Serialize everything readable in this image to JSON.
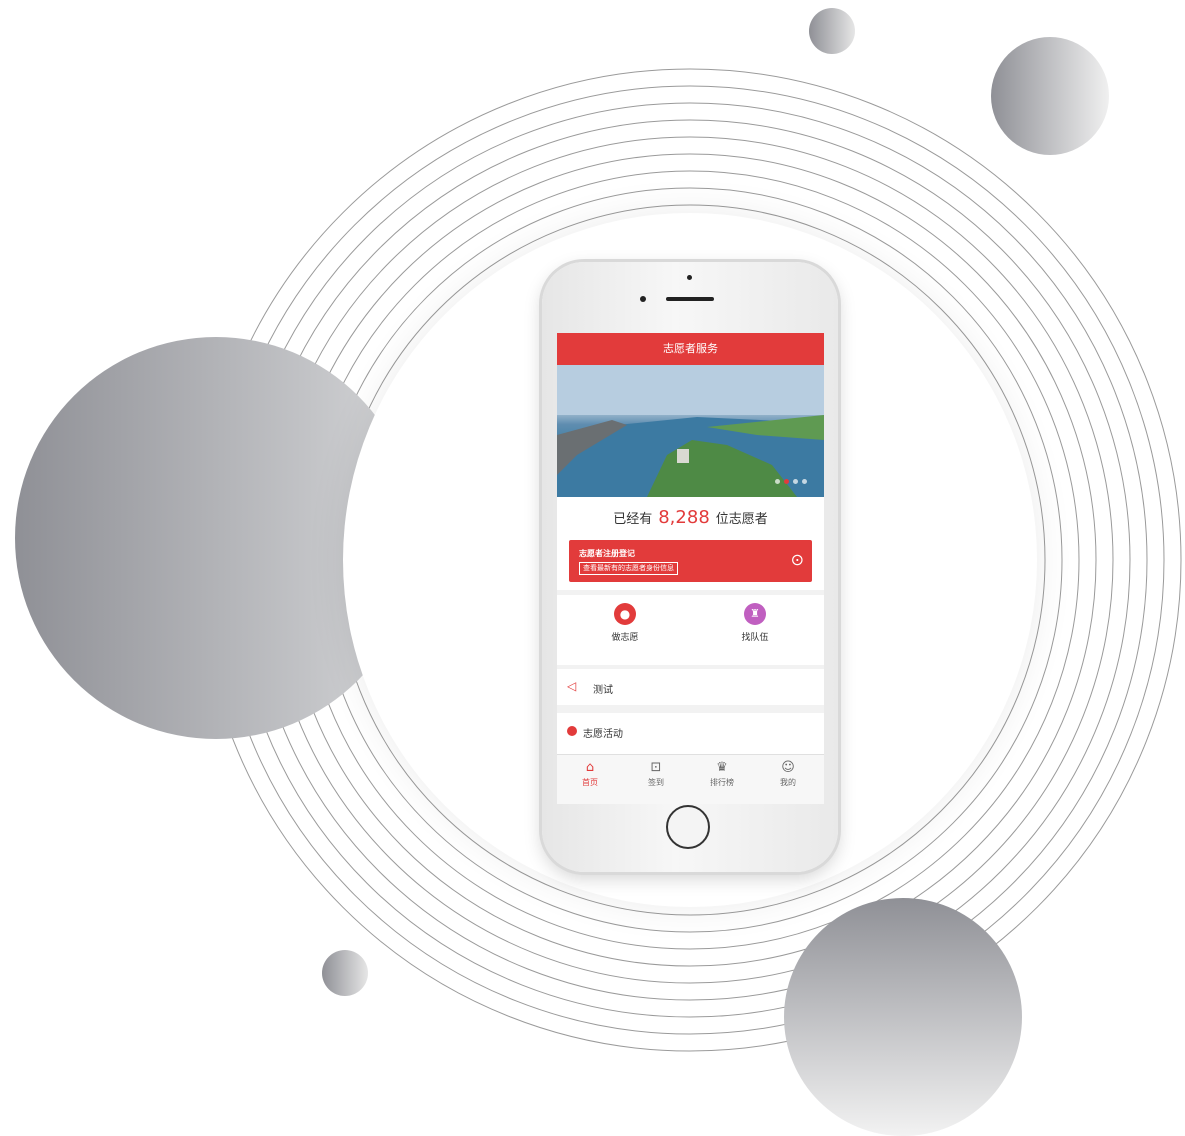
{
  "app": {
    "title": "志愿者服务",
    "carousel": {
      "dots": 4,
      "active": 1
    },
    "counter": {
      "prefix": "已经有",
      "value": "8,288",
      "suffix": "位志愿者"
    },
    "register": {
      "title": "志愿者注册登记",
      "subtitle": "查看最新有的志愿者身份信息",
      "arrow": "⊙"
    },
    "quick_actions": [
      {
        "label": "做志愿",
        "icon": "chat-bubble-icon",
        "color": "#e23b3b"
      },
      {
        "label": "找队伍",
        "icon": "team-icon",
        "color": "#c05fc0"
      }
    ],
    "notice": {
      "icon": "speaker-icon",
      "text": "测试"
    },
    "activity": {
      "icon": "heart-icon",
      "title": "志愿活动"
    },
    "tabs": [
      {
        "label": "首页",
        "icon": "home-icon",
        "active": true
      },
      {
        "label": "签到",
        "icon": "scan-icon",
        "active": false
      },
      {
        "label": "排行榜",
        "icon": "trophy-icon",
        "active": false
      },
      {
        "label": "我的",
        "icon": "user-icon",
        "active": false
      }
    ],
    "colors": {
      "primary": "#e23b3b",
      "secondary": "#c05fc0"
    }
  }
}
